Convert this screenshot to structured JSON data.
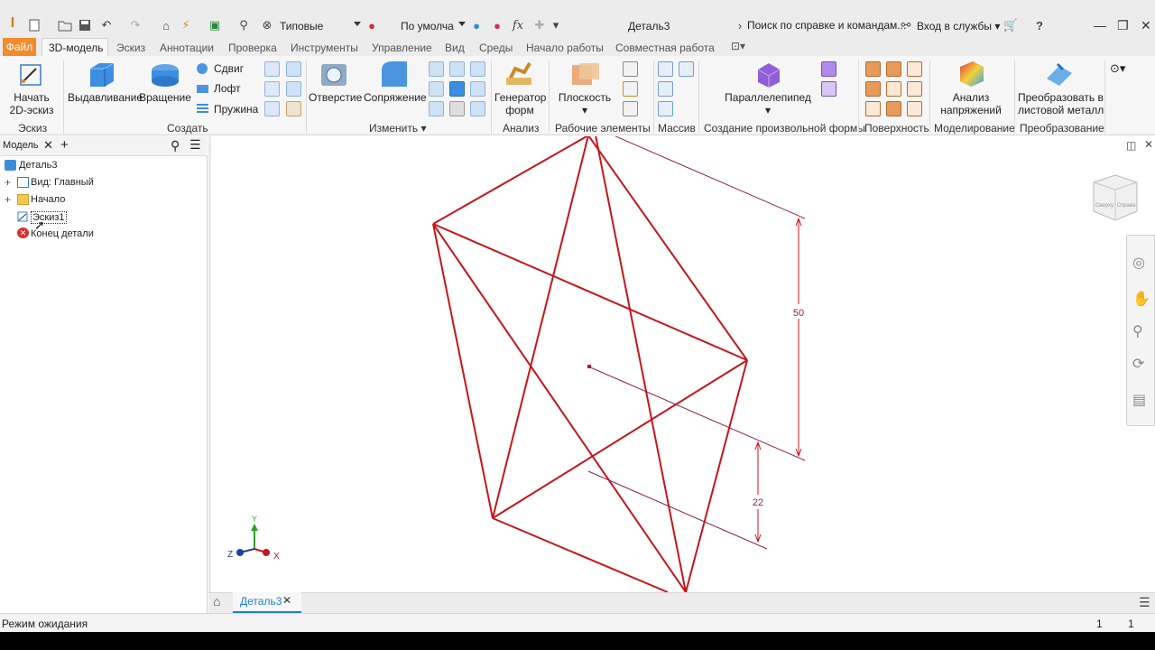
{
  "titlebar": {
    "style_value": "Типовые",
    "appearance_value": "По умолча",
    "fx_label": "fx",
    "doc_title": "Деталь3",
    "help_search_placeholder": "Поиск по справке и командам...",
    "signin_label": "Вход в службы",
    "help_label": "?"
  },
  "tabs": {
    "file": "Файл",
    "items": [
      "3D-модель",
      "Эскиз",
      "Аннотации",
      "Проверка",
      "Инструменты",
      "Управление",
      "Вид",
      "Среды",
      "Начало работы",
      "Совместная работа"
    ]
  },
  "ribbon": {
    "start_sketch": "Начать",
    "start_sketch_2": "2D-эскиз",
    "extrude": "Выдавливание",
    "revolve": "Вращение",
    "sweep": "Сдвиг",
    "loft": "Лофт",
    "coil": "Пружина",
    "hole": "Отверстие",
    "fillet": "Сопряжение",
    "shape_gen_1": "Генератор",
    "shape_gen_2": "форм",
    "plane": "Плоскость",
    "box": "Параллелепипед",
    "stress_1": "Анализ",
    "stress_2": "напряжений",
    "convert_1": "Преобразовать в",
    "convert_2": "листовой металл",
    "groups": {
      "sketch": "Эскиз",
      "create": "Создать",
      "modify": "Изменить",
      "analysis": "Анализ",
      "work_features": "Рабочие элементы",
      "pattern": "Массив",
      "freeform": "Создание произвольной формы",
      "surface": "Поверхность",
      "simulation": "Моделирование",
      "convert": "Преобразование"
    }
  },
  "browser": {
    "tab_label": "Модель",
    "root": "Деталь3",
    "items": [
      "Вид: Главный",
      "Начало",
      "Эскиз1",
      "Конец детали"
    ]
  },
  "canvas": {
    "dimension_50": "50",
    "dimension_22": "22",
    "axis_x": "X",
    "axis_y": "Y",
    "axis_z": "Z",
    "viewcube_left": "Сверху",
    "viewcube_right": "Справа",
    "colors": {
      "sketch": "#c4161c",
      "dim": "#8b2252"
    }
  },
  "doc_tabs": {
    "active": "Деталь3"
  },
  "status": {
    "text": "Режим ожидания",
    "num1": "1",
    "num2": "1"
  }
}
